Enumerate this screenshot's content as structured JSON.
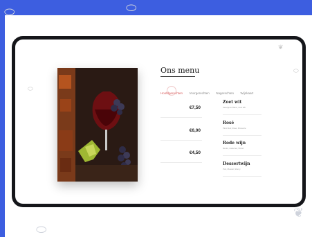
{
  "menu": {
    "title": "Ons menu",
    "tabs": [
      {
        "label": "Hoofdgerechten",
        "active": true
      },
      {
        "label": "Voorgerechten",
        "active": false
      },
      {
        "label": "Nagerechten",
        "active": false
      },
      {
        "label": "Wijnkaart",
        "active": false
      }
    ],
    "prices": [
      "€7,50",
      "€6,00",
      "€4,50"
    ],
    "wines": [
      {
        "name": "Zoet wit",
        "desc": "Sauvignon Blanc, Zoet Wit"
      },
      {
        "name": "Rosé",
        "desc": "Pinot Noir, Rosé, Provence"
      },
      {
        "name": "Rode wijn",
        "desc": "Merlot, Cabernet, Shiraz"
      },
      {
        "name": "Dessertwijn",
        "desc": "Port, Muscat, Sherry"
      }
    ]
  },
  "colors": {
    "brand": "#3d5ee0",
    "active_tab": "#d85a5a",
    "frame": "#15161a"
  },
  "icons": [
    "coffee-bean-doodle-icon",
    "leaf-doodle-icon"
  ]
}
